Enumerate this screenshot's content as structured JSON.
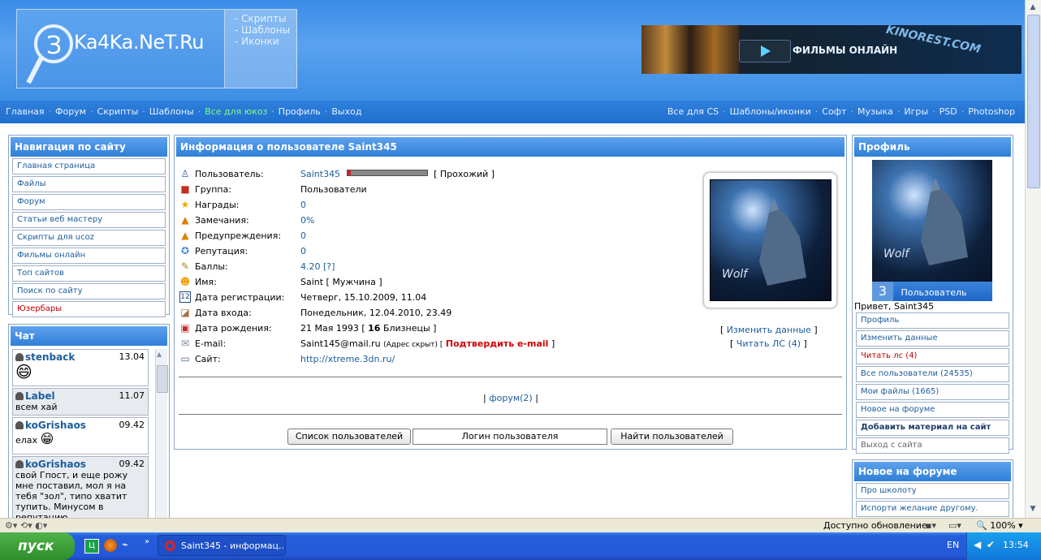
{
  "header": {
    "logo_text": "Ka4Ka.NeT.Ru",
    "logo_links": [
      "- Скрипты",
      "- Шаблоны",
      "- Иконки"
    ],
    "banner_text": "ФИЛЬМЫ ОНЛАЙН",
    "banner_brand": "KINOREST.COM"
  },
  "topmenu": {
    "left": [
      "Главная",
      "Форум",
      "Скрипты",
      "Шаблоны",
      "Все для юкоз",
      "Профиль",
      "Выход"
    ],
    "right": [
      "Все для CS",
      "Шаблоны/иконки",
      "Софт",
      "Музыка",
      "Игры",
      "PSD",
      "Photoshop"
    ]
  },
  "nav_panel": {
    "title": "Навигация по сайту",
    "items": [
      "Главная страница",
      "Файлы",
      "Форум",
      "Статьи веб мастеру",
      "Скрипты для ucoz",
      "Фильмы онлайн",
      "Топ сайтов",
      "Поиск по сайту",
      "Юзербары"
    ]
  },
  "chat_panel": {
    "title": "Чат",
    "messages": [
      {
        "user": "stenback",
        "time": "13.04",
        "text": ""
      },
      {
        "user": "Label",
        "time": "11.07",
        "text": "всем хай"
      },
      {
        "user": "koGrishaos",
        "time": "09.42",
        "text": "елах"
      },
      {
        "user": "koGrishaos",
        "time": "09.42",
        "text": "свой Гпост, и еще рожу мне поставил, мол я на тебя \"зол\", типо хватит тупить. Минусом в репутацию"
      }
    ]
  },
  "main_panel": {
    "title": "Информация о пользователе Saint345",
    "rows": [
      {
        "label": "Пользователь:",
        "value": "Saint345",
        "extra": "[ Прохожий ]"
      },
      {
        "label": "Группа:",
        "value": "Пользователи"
      },
      {
        "label": "Награды:",
        "value": "0"
      },
      {
        "label": "Замечания:",
        "value": "0%"
      },
      {
        "label": "Предупреждения:",
        "value": "0"
      },
      {
        "label": "Репутация:",
        "value": "0"
      },
      {
        "label": "Баллы:",
        "value": "4.20",
        "extra": "[?]"
      },
      {
        "label": "Имя:",
        "value": "Saint [ Мужчина ]"
      },
      {
        "label": "Дата регистрации:",
        "value": "Четверг, 15.10.2009, 11.04"
      },
      {
        "label": "Дата входа:",
        "value": "Понедельник, 12.04.2010, 23.49"
      },
      {
        "label": "Дата рождения:",
        "value": "21 Мая 1993 [",
        "age": "16",
        "zodiac": "Близнецы ]"
      },
      {
        "label": "E-mail:",
        "value": "Saint145@mail.ru",
        "note": "(Адрес скрыт) [",
        "confirm": "Подтвердить e-mail",
        "end": "]"
      },
      {
        "label": "Сайт:",
        "value": "http://xtreme.3dn.ru/"
      }
    ],
    "rating": 0.05,
    "avatar_caption": "Wolf",
    "edit_link": "Изменить данные",
    "read_pm_link": "Читать ЛС (4)",
    "forum_link": "форум(2)",
    "buttons": [
      "Список пользователей",
      "Логин пользователя",
      "Найти пользователей"
    ]
  },
  "profile_panel": {
    "title": "Профиль",
    "avatar_caption": "Wolf",
    "avatar_badge_num": "3",
    "avatar_badge_text": "Пользователь",
    "greeting": "Привет, Saint345",
    "links": [
      "Профиль",
      "Изменить данные",
      "Читать лс (4)",
      "Все пользователи (24535)",
      "Мои файлы (1665)",
      "Новое на форуме",
      "Добавить материал на сайт",
      "Выход с сайта"
    ]
  },
  "forum_panel": {
    "title": "Новое на форуме",
    "links": [
      "Про школоту",
      "Испорти желание другому."
    ]
  },
  "statusbar": {
    "status": "Доступно обновление",
    "zoom": "100%"
  },
  "taskbar": {
    "start": "пуск",
    "task": "Saint345 - информац...",
    "lang": "EN",
    "clock": "13:54"
  }
}
